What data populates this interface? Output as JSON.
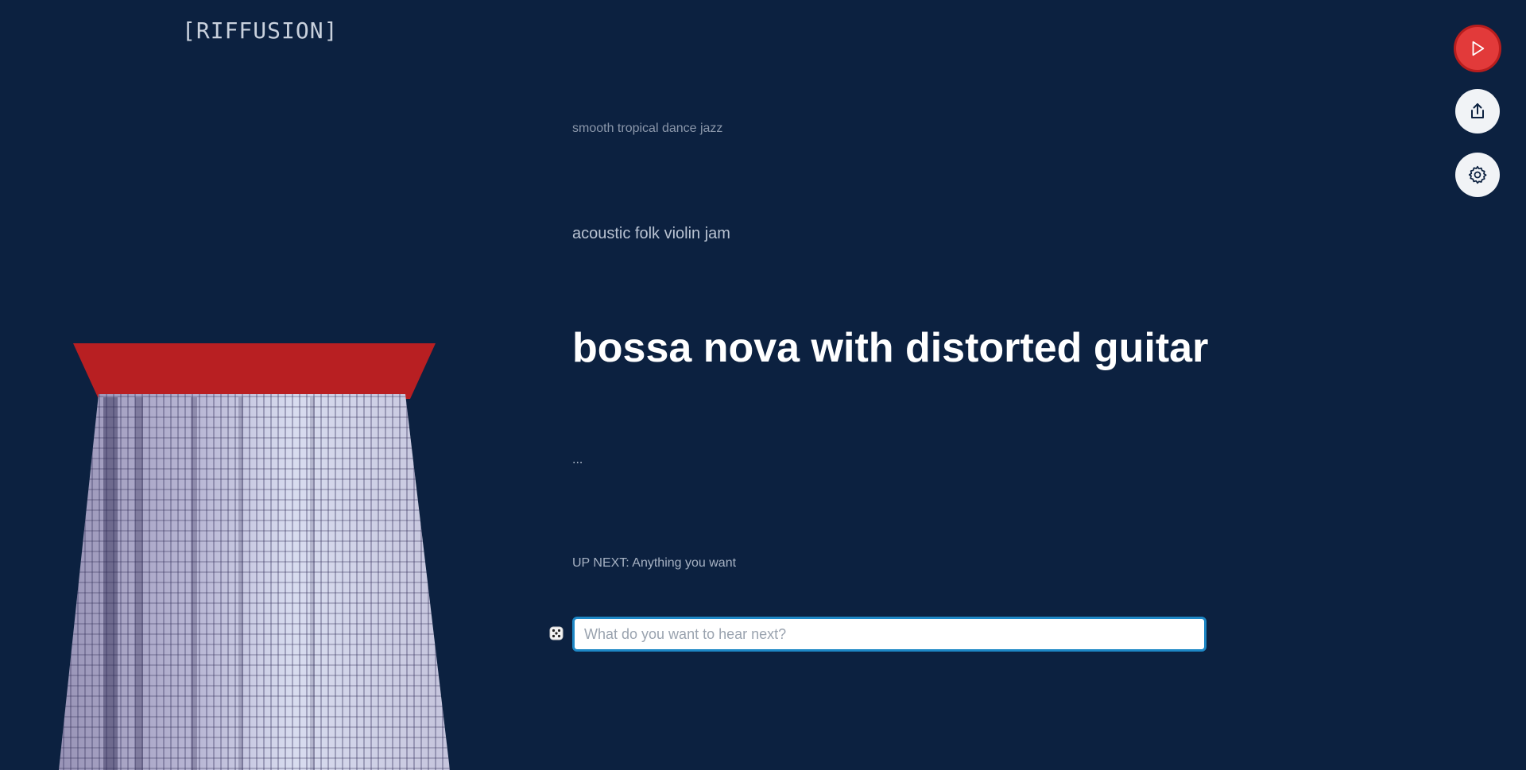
{
  "app": {
    "logo": "[RIFFUSION]"
  },
  "prompts": {
    "far_previous": "smooth tropical dance jazz",
    "previous": "acoustic folk violin jam",
    "current": "bossa nova with distorted guitar",
    "ellipsis": "..."
  },
  "up_next": {
    "label": "UP NEXT: Anything you want"
  },
  "prompt_input": {
    "value": "",
    "placeholder": "What do you want to hear next?"
  },
  "icons": {
    "dice": "dice-icon",
    "play": "play-icon",
    "share": "share-icon",
    "settings": "gear-icon"
  },
  "colors": {
    "background": "#0c2140",
    "accent_red": "#e23a3a",
    "viz_top": "#b81f22",
    "input_border": "#1e88c6"
  }
}
